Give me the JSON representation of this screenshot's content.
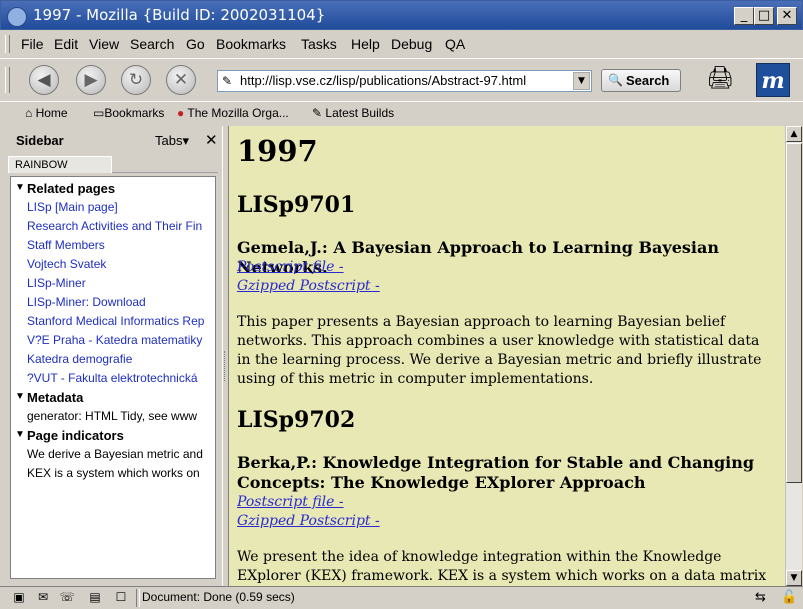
{
  "window": {
    "title": "1997 - Mozilla {Build ID: 2002031104}"
  },
  "menu": [
    "File",
    "Edit",
    "View",
    "Search",
    "Go",
    "Bookmarks",
    "Tasks",
    "Help",
    "Debug",
    "QA"
  ],
  "nav": {
    "url": "http://lisp.vse.cz/lisp/publications/Abstract-97.html",
    "search_label": "Search"
  },
  "bookmarks_bar": {
    "home": "Home",
    "bookmarks": "Bookmarks",
    "mozilla": "The Mozilla Orga...",
    "latest": "Latest Builds"
  },
  "sidebar": {
    "title": "Sidebar",
    "tabs_label": "Tabs",
    "panel_tab": "RAINBOW",
    "sections": [
      {
        "title": "Related pages",
        "items": [
          "LISp [Main page]",
          "Research Activities and Their Fin",
          "Staff Members",
          "Vojtech Svatek",
          "LISp-Miner",
          "LISp-Miner: Download",
          "Stanford Medical Informatics Rep",
          "V?E Praha - Katedra matematiky",
          "Katedra demografie",
          "?VUT - Fakulta elektrotechnická"
        ]
      },
      {
        "title": "Metadata",
        "items": [
          "generator: HTML Tidy, see www"
        ]
      },
      {
        "title": "Page indicators",
        "items": [
          "We derive a Bayesian metric and",
          "KEX is a system which works on"
        ]
      }
    ]
  },
  "content": {
    "heading": "1997",
    "entries": [
      {
        "id": "LISp9701",
        "title": "Gemela,J.: A Bayesian Approach to Learning Bayesian Networks.",
        "links": [
          "Postscript file -",
          "Gzipped Postscript -"
        ],
        "abstract": "This paper presents a Bayesian approach to learning Bayesian belief networks. This approach combines a user knowledge with statistical data in the learning process. We derive a Bayesian metric and briefly illustrate using of this metric in computer implementations."
      },
      {
        "id": "LISp9702",
        "title": "Berka,P.: Knowledge Integration for Stable and Changing Concepts: The Knowledge EXplorer Approach",
        "links": [
          "Postscript file -",
          "Gzipped Postscript -"
        ],
        "abstract": "We present the idea of knowledge integration within the Knowledge EXplorer (KEX) framework. KEX is a system which works on a data matrix using attribute-value"
      }
    ]
  },
  "status": {
    "text": "Document: Done (0.59 secs)"
  }
}
